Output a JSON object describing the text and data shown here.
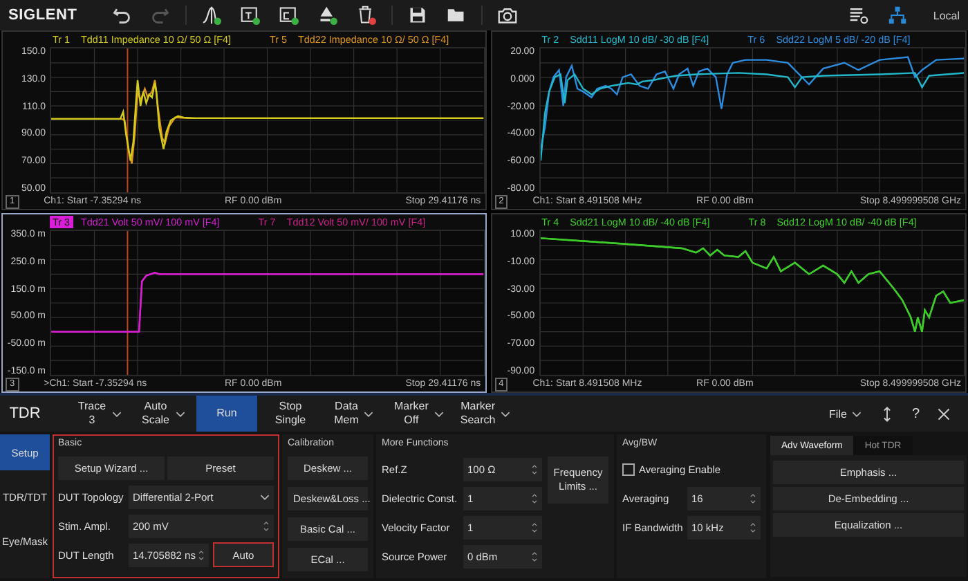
{
  "toolbar": {
    "logo": "SIGLENT",
    "status": "Local"
  },
  "panels": [
    {
      "number": "1",
      "selected": false,
      "traces": [
        {
          "label": "Tr 1",
          "desc": "Tdd11 Impedance 10 Ω/ 50 Ω [F4]",
          "color": "#d4cc1c",
          "selected": false
        },
        {
          "label": "Tr 5",
          "desc": "Tdd22 Impedance 10 Ω/ 50 Ω [F4]",
          "color": "#e0961c",
          "selected": false
        }
      ],
      "y_labels": [
        "150.0",
        "130.0",
        "110.0",
        "90.00",
        "70.00",
        "50.00"
      ],
      "start": "Ch1: Start -7.35294 ns",
      "rf": "RF 0.00 dBm",
      "stop": "Stop 29.41176 ns"
    },
    {
      "number": "2",
      "selected": false,
      "traces": [
        {
          "label": "Tr 2",
          "desc": "Sdd11 LogM 10 dB/ -30 dB [F4]",
          "color": "#22b8cc",
          "selected": false
        },
        {
          "label": "Tr 6",
          "desc": "Sdd22 LogM 5 dB/ -20 dB [F4]",
          "color": "#2c8ce0",
          "selected": false
        }
      ],
      "y_labels": [
        "20.00",
        "0.000",
        "-20.00",
        "-40.00",
        "-60.00",
        "-80.00"
      ],
      "start": "Ch1: Start 8.491508 MHz",
      "rf": "RF 0.00 dBm",
      "stop": "Stop 8.499999508 GHz"
    },
    {
      "number": "3",
      "selected": true,
      "traces": [
        {
          "label": "Tr 3",
          "desc": "Tdd21 Volt 50 mV/ 100 mV [F4]",
          "color": "#d81ed8",
          "selected": true
        },
        {
          "label": "Tr 7",
          "desc": "Tdd12 Volt 50 mV/ 100 mV [F4]",
          "color": "#d0208c",
          "selected": false
        }
      ],
      "y_labels": [
        "350.0 m",
        "250.0 m",
        "150.0 m",
        "50.00 m",
        "-50.00 m",
        "-150.0 m"
      ],
      "start": ">Ch1: Start -7.35294 ns",
      "rf": "RF 0.00 dBm",
      "stop": "Stop 29.41176 ns"
    },
    {
      "number": "4",
      "selected": false,
      "traces": [
        {
          "label": "Tr 4",
          "desc": "Sdd21 LogM 10 dB/ -40 dB [F4]",
          "color": "#3ccc28",
          "selected": false
        },
        {
          "label": "Tr 8",
          "desc": "Sdd12 LogM 10 dB/ -40 dB [F4]",
          "color": "#44d030",
          "selected": false
        }
      ],
      "y_labels": [
        "10.00",
        "-10.00",
        "-30.00",
        "-50.00",
        "-70.00",
        "-90.00"
      ],
      "start": "Ch1: Start 8.491508 MHz",
      "rf": "RF 0.00 dBm",
      "stop": "Stop 8.499999508 GHz"
    }
  ],
  "menu": {
    "title": "TDR",
    "softkeys": [
      {
        "lines": [
          "Trace",
          "3"
        ],
        "menu": true,
        "selected": false
      },
      {
        "lines": [
          "Auto",
          "Scale"
        ],
        "menu": true,
        "selected": false
      },
      {
        "lines": [
          "Run"
        ],
        "menu": false,
        "selected": true
      },
      {
        "lines": [
          "Stop",
          "Single"
        ],
        "menu": false,
        "selected": false
      },
      {
        "lines": [
          "Data",
          "Mem"
        ],
        "menu": true,
        "selected": false
      },
      {
        "lines": [
          "Marker",
          "Off"
        ],
        "menu": true,
        "selected": false
      },
      {
        "lines": [
          "Marker",
          "Search"
        ],
        "menu": true,
        "selected": false
      }
    ],
    "file": "File",
    "help": "?"
  },
  "side_tabs": [
    {
      "label": "Setup",
      "selected": true
    },
    {
      "label": "TDR/TDT",
      "selected": false
    },
    {
      "label": "Eye/Mask",
      "selected": false
    }
  ],
  "basic": {
    "title": "Basic",
    "highlighted": true,
    "buttons": [
      "Setup Wizard ...",
      "Preset"
    ],
    "fields": [
      {
        "label": "DUT Topology",
        "value": "Differential 2-Port",
        "kind": "dropdown"
      },
      {
        "label": "Stim. Ampl.",
        "value": "200 mV",
        "kind": "spinner"
      },
      {
        "label": "DUT Length",
        "value": "14.705882 ns",
        "kind": "spinner"
      }
    ],
    "auto_button": {
      "label": "Auto",
      "highlighted": true
    }
  },
  "calibration": {
    "title": "Calibration",
    "buttons": [
      "Deskew ...",
      "Deskew&Loss ...",
      "Basic Cal ...",
      "ECal ..."
    ]
  },
  "more": {
    "title": "More Functions",
    "fields": [
      {
        "label": "Ref.Z",
        "value": "100 Ω"
      },
      {
        "label": "Dielectric Const.",
        "value": "1"
      },
      {
        "label": "Velocity Factor",
        "value": "1"
      },
      {
        "label": "Source Power",
        "value": "0 dBm"
      }
    ],
    "button": "Frequency Limits ..."
  },
  "avg": {
    "title": "Avg/BW",
    "checkbox": {
      "label": "Averaging Enable",
      "checked": false
    },
    "fields": [
      {
        "label": "Averaging",
        "value": "16"
      },
      {
        "label": "IF Bandwidth",
        "value": "10 kHz"
      }
    ]
  },
  "adv": {
    "tabs": [
      {
        "label": "Adv Waveform",
        "selected": true
      },
      {
        "label": "Hot TDR",
        "selected": false
      }
    ],
    "buttons": [
      "Emphasis ...",
      "De-Embedding ...",
      "Equalization ..."
    ]
  }
}
